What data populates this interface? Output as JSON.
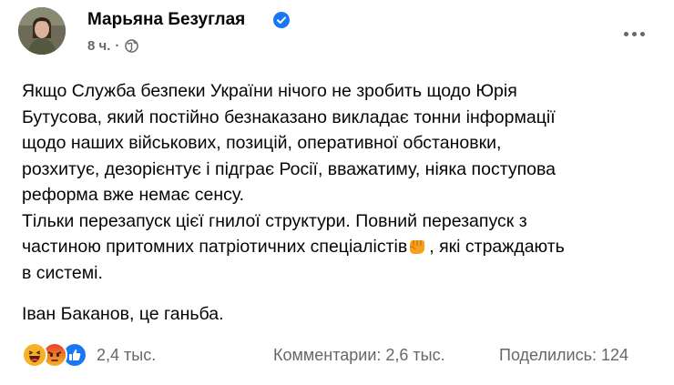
{
  "post": {
    "author": "Марьяна Безуглая",
    "verified_icon": "verified-check-icon",
    "timestamp": "8 ч.",
    "separator": "·",
    "audience_icon": "globe-icon",
    "menu_icon": "more-horizontal-icon",
    "paragraphs": [
      [
        "Якщо Служба безпеки України нічого не зробить щодо Юрія",
        "Бутусова, який постійно безнаказано викладає тонни інформації",
        "щодо наших військових, позицій, оперативної обстановки,",
        "розхитує, дезорієнтує і підграє Росії, вважатиму, ніяка поступова",
        "реформа вже немає сенсу.",
        "Тільки перезапуск цієї гнилої структури. Повний перезапуск з"
      ],
      {
        "before_emoji": "частиною притомних патріотичних спеціалістів",
        "emoji": "raised-fist-emoji",
        "after_emoji": ", які страждають"
      },
      "в системі.",
      "Іван Баканов, це ганьба."
    ]
  },
  "footer": {
    "reactions": [
      "haha-reaction-icon",
      "angry-reaction-icon",
      "like-reaction-icon"
    ],
    "reaction_count": "2,4 тыс.",
    "comments": "Комментарии: 2,6 тыс.",
    "shares": "Поделились: 124"
  },
  "colors": {
    "text": "#050505",
    "secondary": "#65676b",
    "verified": "#1877f2",
    "like": "#1877f2",
    "haha": "#f7b125",
    "angry": "#e9710f"
  }
}
